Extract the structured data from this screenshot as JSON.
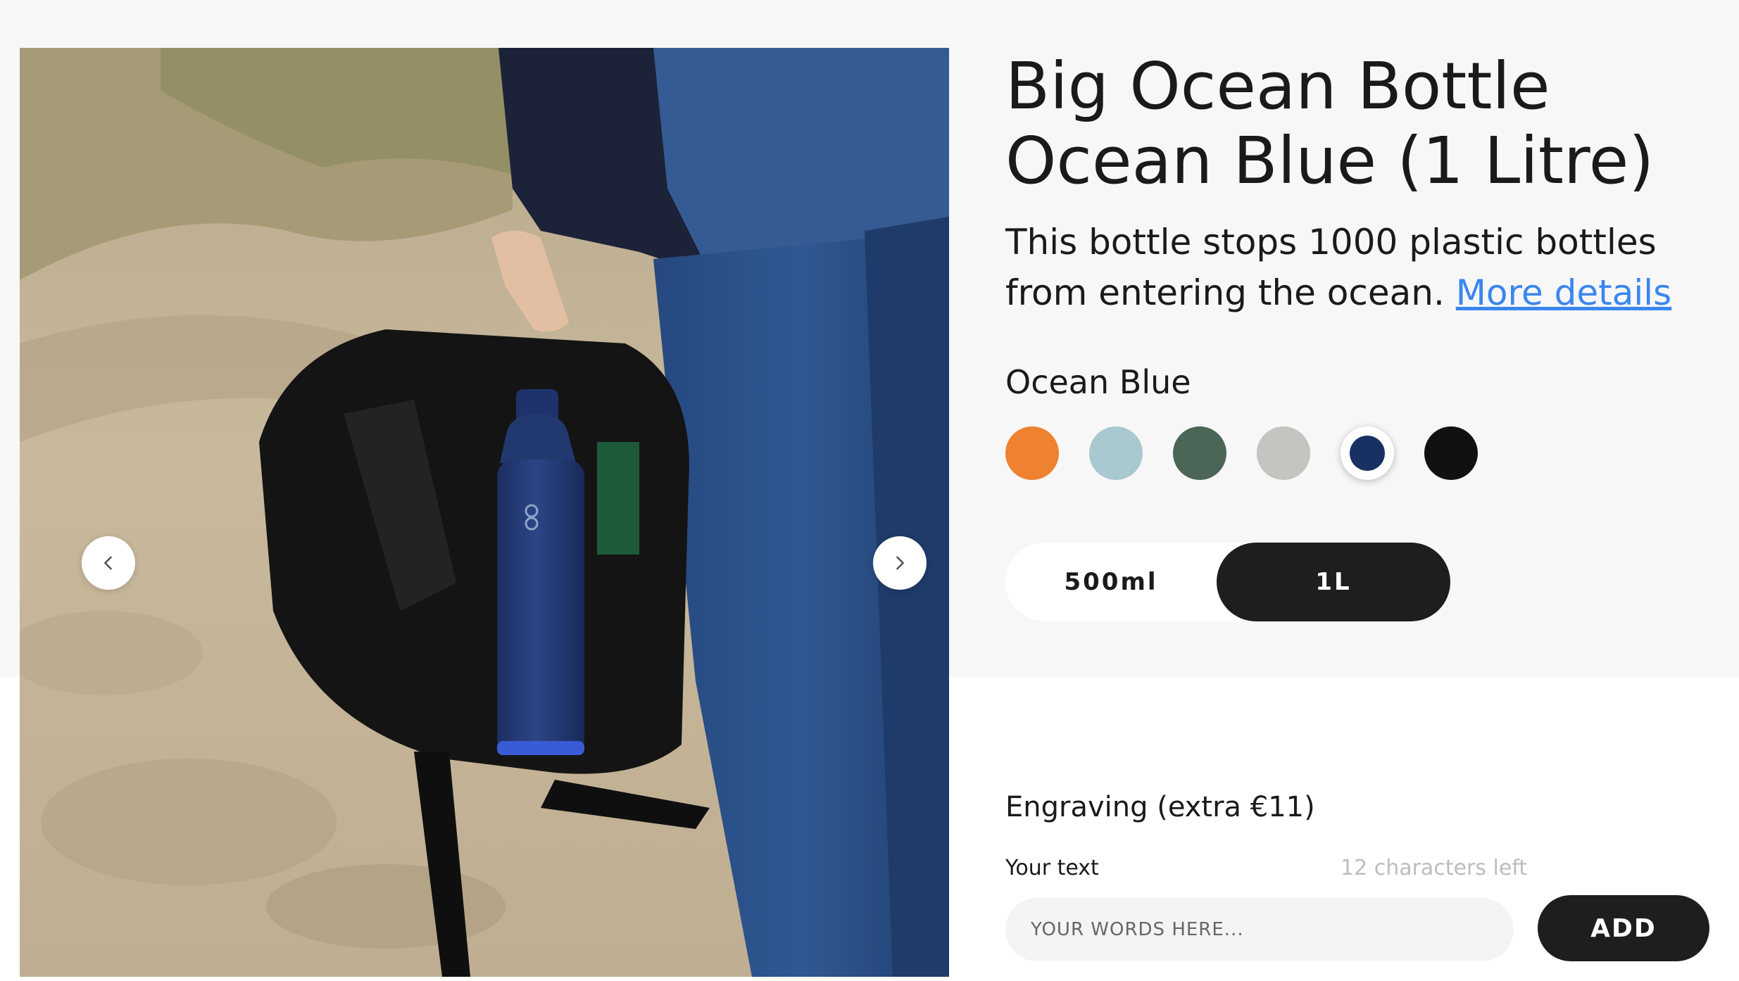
{
  "product": {
    "title_line1": "Big Ocean Bottle",
    "title_line2": "Ocean Blue (1 Litre)",
    "description": "This bottle stops 1000 plastic bottles from entering the ocean.",
    "more_details_link": "More details"
  },
  "gallery": {
    "prev_icon": "chevron-left-icon",
    "next_icon": "chevron-right-icon"
  },
  "color": {
    "selected_name": "Ocean Blue",
    "swatches": [
      {
        "name": "orange",
        "hex": "#ee8230",
        "selected": false
      },
      {
        "name": "light-blue",
        "hex": "#a9c8d0",
        "selected": false
      },
      {
        "name": "forest-green",
        "hex": "#4b6657",
        "selected": false
      },
      {
        "name": "light-grey",
        "hex": "#c4c4c0",
        "selected": false
      },
      {
        "name": "ocean-blue",
        "hex": "#173262",
        "selected": true
      },
      {
        "name": "black",
        "hex": "#111111",
        "selected": false
      }
    ]
  },
  "size": {
    "options": [
      "500ml",
      "1L"
    ],
    "selected": "1L"
  },
  "engraving": {
    "title": "Engraving (extra €11)",
    "label": "Your text",
    "chars_left": "12 characters left",
    "placeholder": "YOUR WORDS HERE...",
    "value": "",
    "add_label": "ADD"
  },
  "colors": {
    "page_bg": "#f7f7f7",
    "link": "#3a86f0",
    "dark_button": "#1e1e1e"
  }
}
